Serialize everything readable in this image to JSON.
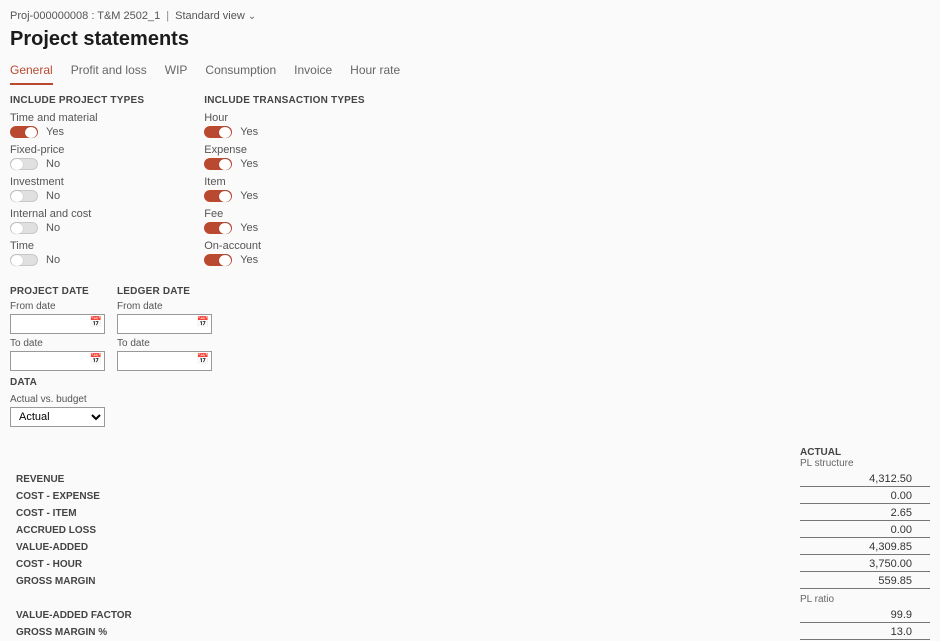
{
  "breadcrumb": {
    "project": "Proj-000000008 : T&M 2502_1",
    "view": "Standard view"
  },
  "title": "Project statements",
  "tabs": [
    "General",
    "Profit and loss",
    "WIP",
    "Consumption",
    "Invoice",
    "Hour rate"
  ],
  "active_tab": 0,
  "include_project_types": {
    "header": "INCLUDE PROJECT TYPES",
    "items": [
      {
        "label": "Time and material",
        "value": "Yes",
        "on": true
      },
      {
        "label": "Fixed-price",
        "value": "No",
        "on": false
      },
      {
        "label": "Investment",
        "value": "No",
        "on": false
      },
      {
        "label": "Internal and cost",
        "value": "No",
        "on": false
      },
      {
        "label": "Time",
        "value": "No",
        "on": false
      }
    ]
  },
  "include_transaction_types": {
    "header": "INCLUDE TRANSACTION TYPES",
    "items": [
      {
        "label": "Hour",
        "value": "Yes",
        "on": true
      },
      {
        "label": "Expense",
        "value": "Yes",
        "on": true
      },
      {
        "label": "Item",
        "value": "Yes",
        "on": true
      },
      {
        "label": "Fee",
        "value": "Yes",
        "on": true
      },
      {
        "label": "On-account",
        "value": "Yes",
        "on": true
      }
    ]
  },
  "project_date": {
    "header": "PROJECT DATE",
    "from_label": "From date",
    "from_value": "",
    "to_label": "To date",
    "to_value": ""
  },
  "ledger_date": {
    "header": "LEDGER DATE",
    "from_label": "From date",
    "from_value": "",
    "to_label": "To date",
    "to_value": ""
  },
  "data_section": {
    "header": "DATA",
    "label": "Actual vs. budget",
    "selected": "Actual"
  },
  "results": {
    "actual_header": "ACTUAL",
    "pl_structure_label": "PL structure",
    "pl_ratio_label": "PL ratio",
    "structure_rows": [
      {
        "label": "REVENUE",
        "value": "4,312.50"
      },
      {
        "label": "COST - EXPENSE",
        "value": "0.00"
      },
      {
        "label": "COST - ITEM",
        "value": "2.65"
      },
      {
        "label": "ACCRUED LOSS",
        "value": "0.00"
      },
      {
        "label": "VALUE-ADDED",
        "value": "4,309.85"
      },
      {
        "label": "COST - HOUR",
        "value": "3,750.00"
      },
      {
        "label": "GROSS MARGIN",
        "value": "559.85"
      }
    ],
    "ratio_rows": [
      {
        "label": "VALUE-ADDED FACTOR",
        "value": "99.9"
      },
      {
        "label": "GROSS MARGIN %",
        "value": "13.0"
      }
    ]
  }
}
